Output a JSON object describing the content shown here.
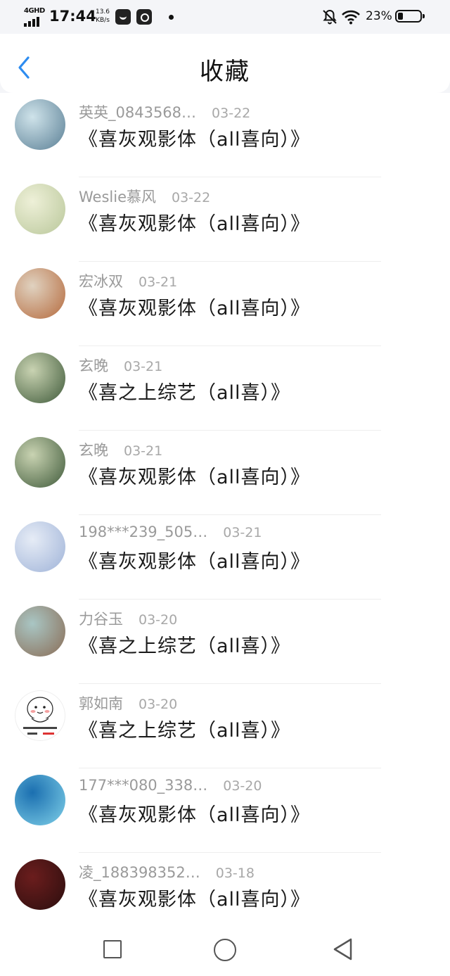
{
  "status_bar": {
    "network_type": "4GHD",
    "time": "17:44",
    "speed_value": "13.6",
    "speed_unit": "KB/s",
    "battery_percent": "23%"
  },
  "header": {
    "title": "收藏"
  },
  "favorites": [
    {
      "user": "英英_0843568…",
      "date": "03-22",
      "title": "《喜灰观影体（all喜向）》",
      "avatar_colors": [
        "#cfe3ea",
        "#5a7f95"
      ]
    },
    {
      "user": "Weslie慕风",
      "date": "03-22",
      "title": "《喜灰观影体（all喜向）》",
      "avatar_colors": [
        "#eef0d8",
        "#b9c79a"
      ]
    },
    {
      "user": "宏冰双",
      "date": "03-21",
      "title": "《喜灰观影体（all喜向）》",
      "avatar_colors": [
        "#e0d2c0",
        "#b56a3d"
      ]
    },
    {
      "user": "玄晚",
      "date": "03-21",
      "title": "《喜之上综艺（all喜）》",
      "avatar_colors": [
        "#c9d3b2",
        "#3f5a3a"
      ]
    },
    {
      "user": "玄晚",
      "date": "03-21",
      "title": "《喜灰观影体（all喜向）》",
      "avatar_colors": [
        "#c9d3b2",
        "#3f5a3a"
      ]
    },
    {
      "user": "198***239_505…",
      "date": "03-21",
      "title": "《喜灰观影体（all喜向）》",
      "avatar_colors": [
        "#e6ecf6",
        "#9fb3d8"
      ]
    },
    {
      "user": "力谷玉",
      "date": "03-20",
      "title": "《喜之上综艺（all喜）》",
      "avatar_colors": [
        "#a9c6c4",
        "#8a6c55"
      ]
    },
    {
      "user": "郭如南",
      "date": "03-20",
      "title": "《喜之上综艺（all喜）》",
      "avatar_colors": [
        "#ffffff",
        "#f1f1f1"
      ]
    },
    {
      "user": "177***080_338…",
      "date": "03-20",
      "title": "《喜灰观影体（all喜向）》",
      "avatar_colors": [
        "#1b6fb0",
        "#7fd0e8"
      ]
    },
    {
      "user": "凌_188398352…",
      "date": "03-18",
      "title": "《喜灰观影体（all喜向）》",
      "avatar_colors": [
        "#6b1d1d",
        "#2b0e0e"
      ]
    }
  ],
  "colors": {
    "accent": "#2d8cf0",
    "text_primary": "#1a1a1a",
    "text_secondary": "#9a9a9a"
  },
  "icons": {
    "back": "chevron-left-icon",
    "bell": "bell-off-icon",
    "wifi": "wifi-icon",
    "battery": "battery-icon",
    "nav_recent": "square-icon",
    "nav_home": "circle-icon",
    "nav_back": "triangle-back-icon"
  }
}
